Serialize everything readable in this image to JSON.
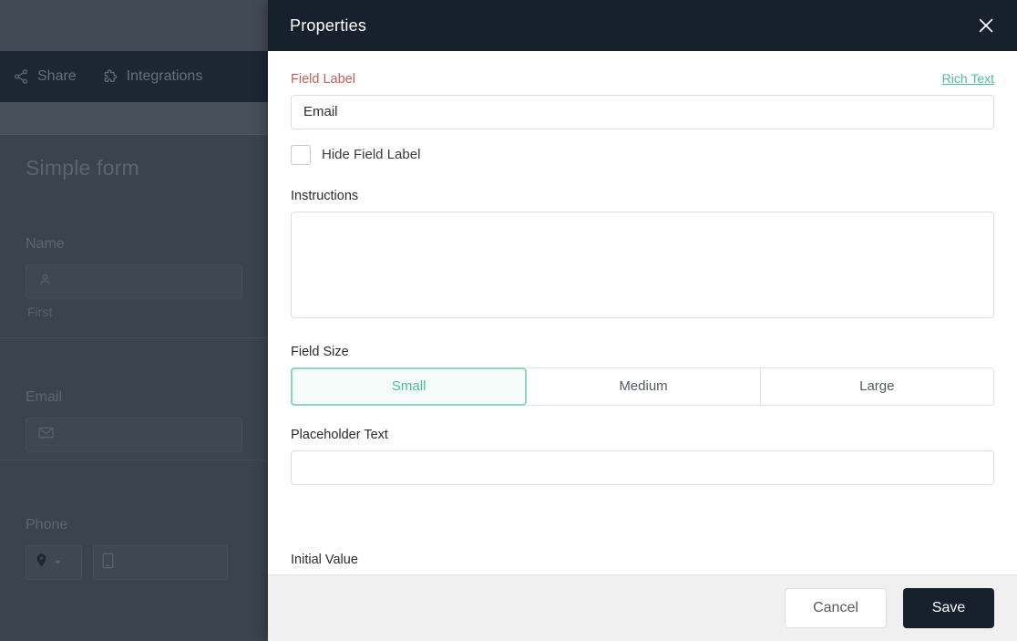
{
  "background_app": {
    "nav": [
      {
        "label": "Share",
        "icon": "share-icon"
      },
      {
        "label": "Integrations",
        "icon": "puzzle-piece-icon"
      }
    ],
    "form_title": "Simple form",
    "fields": [
      {
        "label": "Name",
        "sublabel": "First",
        "icon": "person-icon"
      },
      {
        "label": "Email",
        "sublabel": "",
        "icon": "envelope-icon"
      },
      {
        "label": "Phone",
        "sublabel": "",
        "icon": "location-pin-icon",
        "secondary_icon": "phone-icon",
        "dropdown_icon": "caret-down-icon"
      }
    ]
  },
  "modal": {
    "title": "Properties",
    "close_icon": "close-icon",
    "field_label": {
      "label": "Field Label",
      "rich_text_link": "Rich Text",
      "value": "Email",
      "placeholder": ""
    },
    "hide_field_label": {
      "label": "Hide Field Label",
      "checked": false
    },
    "instructions": {
      "label": "Instructions",
      "value": "",
      "placeholder": ""
    },
    "field_size": {
      "label": "Field Size",
      "options": [
        "Small",
        "Medium",
        "Large"
      ],
      "selected": "Small"
    },
    "placeholder_text": {
      "label": "Placeholder Text",
      "value": "",
      "placeholder": ""
    },
    "initial_value": {
      "label": "Initial Value"
    },
    "footer": {
      "cancel_label": "Cancel",
      "save_label": "Save"
    }
  },
  "colors": {
    "header_bg": "#17212e",
    "accent_teal": "#4bbd9c",
    "accent_teal_border": "#8ed4c3",
    "required_red": "#c4605c",
    "footer_bg": "#f0f0f0"
  }
}
